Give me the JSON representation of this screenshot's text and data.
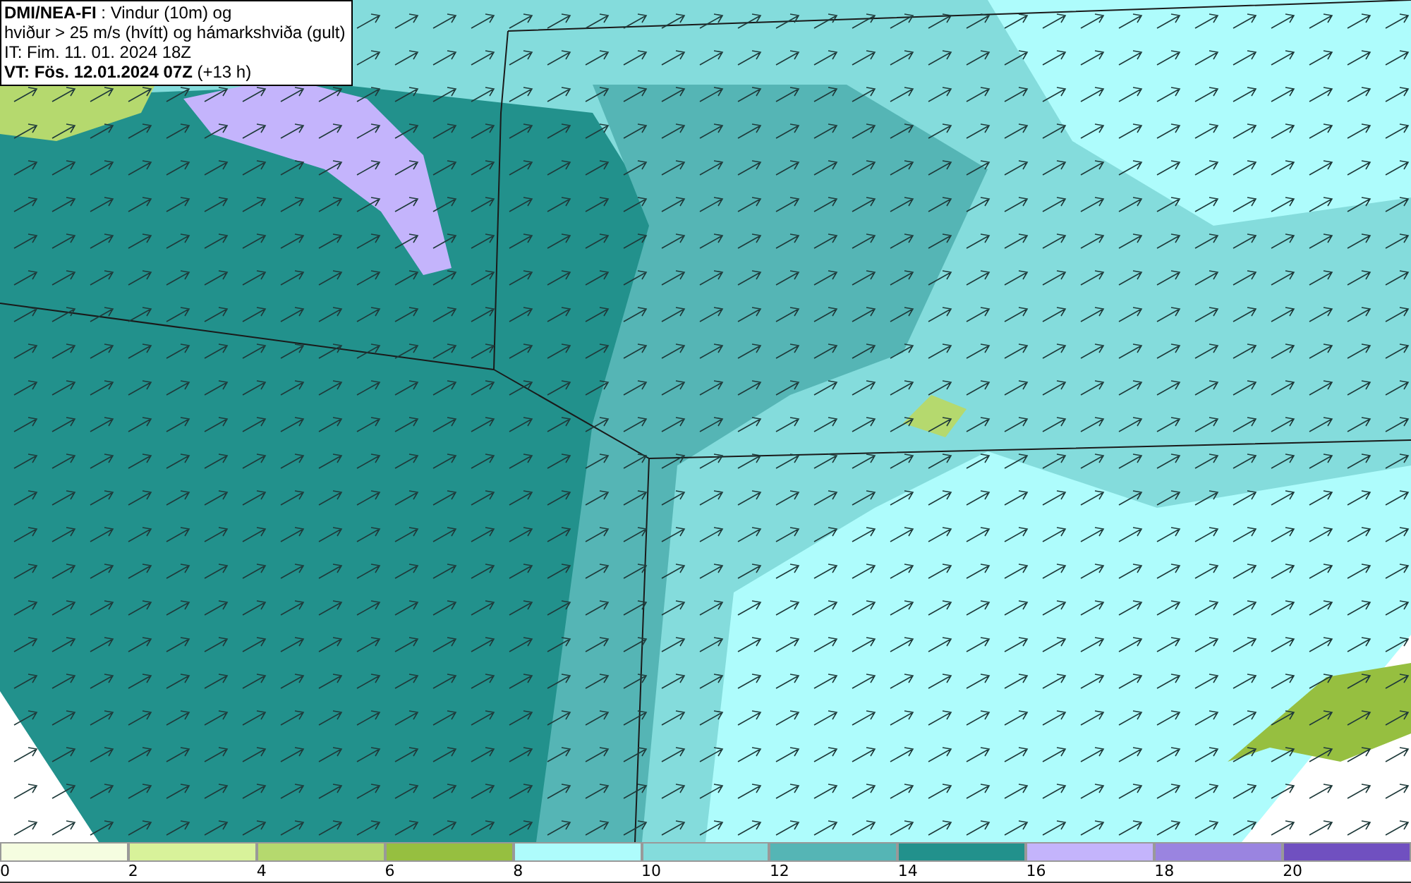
{
  "info_box": {
    "lines": [
      "**DMI/NEA-FI** : Vindur (10m) og",
      "hviður > 25 m/s (hvítt) og hámarkshviða (gult)",
      "IT: Fim. 11. 01. 2024 18Z",
      "**VT: Fös. 12.01.2024 07Z** (+13 h)"
    ]
  },
  "legend": {
    "bins": [
      {
        "label": "0",
        "color": "#f5fde0"
      },
      {
        "label": "2",
        "color": "#d8f29a"
      },
      {
        "label": "4",
        "color": "#b5d96e"
      },
      {
        "label": "6",
        "color": "#96bf40"
      },
      {
        "label": "8",
        "color": "#aefcfc"
      },
      {
        "label": "10",
        "color": "#84dcdc"
      },
      {
        "label": "12",
        "color": "#55b5b5"
      },
      {
        "label": "14",
        "color": "#22918c"
      },
      {
        "label": "16",
        "color": "#c4b4fc"
      },
      {
        "label": "18",
        "color": "#9a84e0"
      },
      {
        "label": "20",
        "color": "#7050c0"
      }
    ]
  }
}
